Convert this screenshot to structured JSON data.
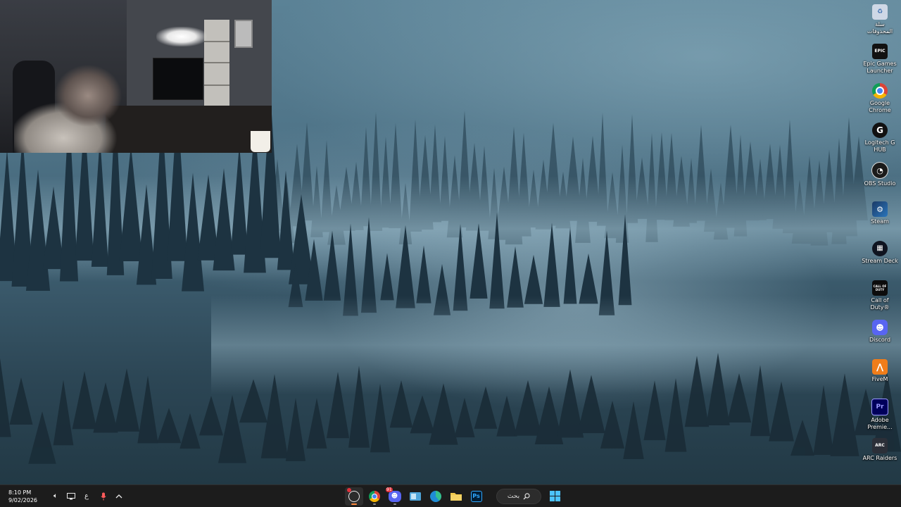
{
  "desktop": {
    "icons": [
      {
        "label": "سلة المحذوفات",
        "icon": "recycle-bin-icon",
        "color": "#cfd8e6"
      },
      {
        "label": "Epic Games Launcher",
        "icon": "epic-games-icon",
        "color": "#111111",
        "glyph": "EPIC"
      },
      {
        "label": "Google Chrome",
        "icon": "chrome-icon",
        "color": "#ffffff"
      },
      {
        "label": "Logitech G HUB",
        "icon": "logitech-g-icon",
        "color": "#111111"
      },
      {
        "label": "OBS Studio",
        "icon": "obs-icon",
        "color": "#1b1b1b"
      },
      {
        "label": "Steam",
        "icon": "steam-icon",
        "color": "#1b3a66"
      },
      {
        "label": "Stream Deck",
        "icon": "stream-deck-icon",
        "color": "#0f1420"
      },
      {
        "label": "Call of Duty®",
        "icon": "call-of-duty-icon",
        "color": "#0c0c0c",
        "glyph": "CALL OF DUTY"
      },
      {
        "label": "Discord",
        "icon": "discord-icon",
        "color": "#5865f2"
      },
      {
        "label": "FiveM",
        "icon": "fivem-icon",
        "color": "#f07d1a"
      },
      {
        "label": "Adobe Premie...",
        "icon": "premiere-pro-icon",
        "color": "#00005b",
        "glyph": "Pr"
      },
      {
        "label": "ARC Raiders",
        "icon": "arc-raiders-icon",
        "color": "#2b2f38",
        "glyph": "ARC"
      }
    ]
  },
  "webcam": {
    "description_label": "webcam-overlay"
  },
  "taskbar": {
    "clock_time": "8:10 PM",
    "clock_date": "9/02/2026",
    "language": "ع",
    "search_label": "بحث",
    "apps": [
      {
        "name": "obs",
        "icon": "obs-icon",
        "active": true,
        "badge": true
      },
      {
        "name": "chrome",
        "icon": "chrome-icon",
        "active": false
      },
      {
        "name": "discord",
        "icon": "discord-icon",
        "active": false,
        "badge_text": "91"
      },
      {
        "name": "task-view",
        "icon": "task-view-icon",
        "active": false
      },
      {
        "name": "edge",
        "icon": "edge-icon",
        "active": false
      },
      {
        "name": "file-explorer",
        "icon": "folder-icon",
        "active": false
      },
      {
        "name": "photoshop",
        "icon": "photoshop-icon",
        "active": false,
        "glyph": "Ps"
      }
    ],
    "accent": "#4cc2ff"
  }
}
